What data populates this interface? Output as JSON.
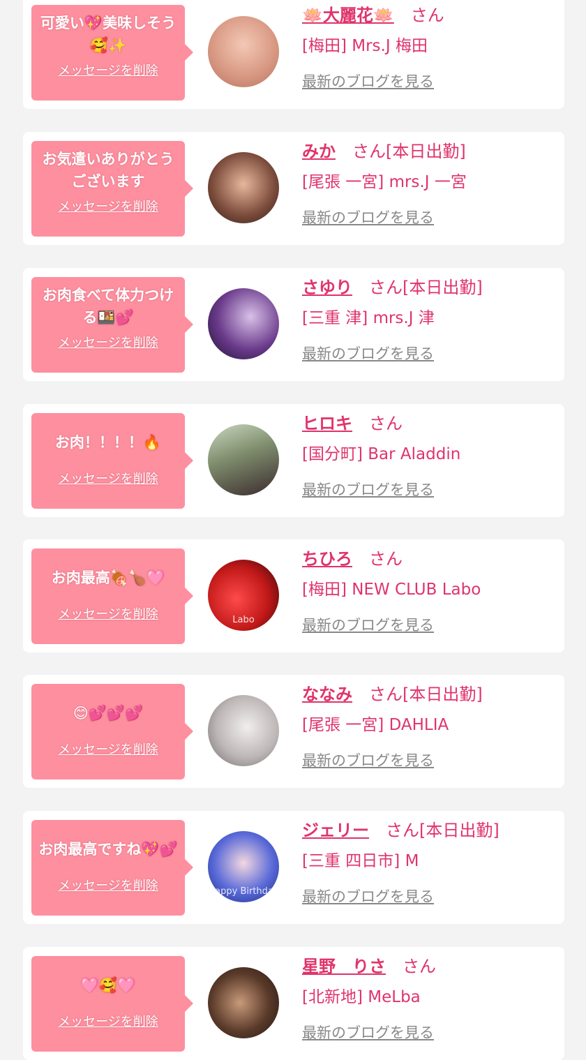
{
  "colors": {
    "page_bg": "#f3f3f3",
    "card_bg": "#ffffff",
    "bubble_bg": "#fd8f9f",
    "accent": "#e0336b",
    "muted": "#888888"
  },
  "messages": [
    {
      "text": "可愛い💖美味しそう🥰✨",
      "delete_label": "メッセージを削除",
      "name": "🪷大麗花🪷",
      "suffix": "さん",
      "shop": "[梅田] Mrs.J 梅田",
      "blog_link": "最新のブログを見る",
      "avatar_icon": "user-photo-icon"
    },
    {
      "text": "お気遣いありがとうございます",
      "delete_label": "メッセージを削除",
      "name": "みか",
      "suffix": "さん[本日出勤]",
      "shop": "[尾張 一宮] mrs.J 一宮",
      "blog_link": "最新のブログを見る",
      "avatar_icon": "user-photo-icon"
    },
    {
      "text": "お肉食べて体力つける🍱💕",
      "delete_label": "メッセージを削除",
      "name": "さゆり",
      "suffix": "さん[本日出勤]",
      "shop": "[三重 津] mrs.J 津",
      "blog_link": "最新のブログを見る",
      "avatar_icon": "user-photo-icon"
    },
    {
      "text": "お肉！！！！🔥",
      "delete_label": "メッセージを削除",
      "name": "ヒロキ",
      "suffix": "さん",
      "shop": "[国分町] Bar Aladdin",
      "blog_link": "最新のブログを見る",
      "avatar_icon": "user-photo-icon"
    },
    {
      "text": "お肉最高🍖🍗🩷",
      "delete_label": "メッセージを削除",
      "name": "ちひろ",
      "suffix": "さん",
      "shop": "[梅田] NEW CLUB Labo",
      "blog_link": "最新のブログを見る",
      "avatar_icon": "user-photo-icon",
      "avatar_text": "Labo"
    },
    {
      "text": "😊💕💕💕",
      "delete_label": "メッセージを削除",
      "name": "ななみ",
      "suffix": "さん[本日出勤]",
      "shop": "[尾張 一宮] DAHLIA",
      "blog_link": "最新のブログを見る",
      "avatar_icon": "user-photo-icon"
    },
    {
      "text": "お肉最高ですね💖💕",
      "delete_label": "メッセージを削除",
      "name": "ジェリー",
      "suffix": "さん[本日出勤]",
      "shop": "[三重 四日市] M",
      "blog_link": "最新のブログを見る",
      "avatar_icon": "user-photo-icon",
      "avatar_text": "Happy Birthday"
    },
    {
      "text": "🩷🥰🩷",
      "delete_label": "メッセージを削除",
      "name": "星野　りさ",
      "suffix": "さん",
      "shop": "[北新地] MeLba",
      "blog_link": "最新のブログを見る",
      "avatar_icon": "user-photo-icon"
    }
  ]
}
